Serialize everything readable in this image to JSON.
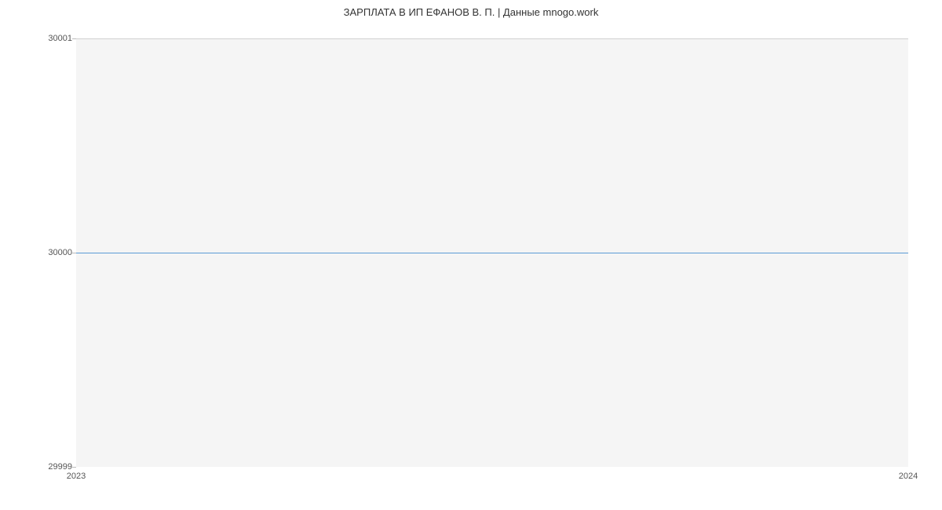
{
  "chart_data": {
    "type": "line",
    "title": "ЗАРПЛАТА В ИП ЕФАНОВ В. П. | Данные mnogo.work",
    "x": [
      2023,
      2024
    ],
    "values": [
      30000,
      30000
    ],
    "xlabel": "",
    "ylabel": "",
    "xlim": [
      2023,
      2024
    ],
    "ylim": [
      29999,
      30001
    ],
    "y_ticks": [
      29999,
      30000,
      30001
    ],
    "x_ticks": [
      2023,
      2024
    ],
    "line_color": "#5b9bd5"
  }
}
